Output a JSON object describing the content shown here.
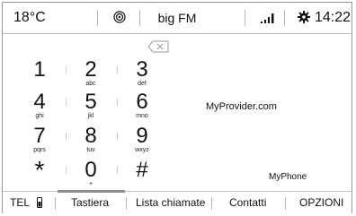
{
  "status_bar": {
    "temperature": "18°C",
    "radio_icon": "radio-signal-icon",
    "station": "big FM",
    "signal_icon": "signal-bars-icon",
    "settings_icon": "gear-icon",
    "time": "14:22"
  },
  "dialpad": {
    "keys": [
      {
        "digit": "1",
        "letters": ""
      },
      {
        "digit": "2",
        "letters": "abc"
      },
      {
        "digit": "3",
        "letters": "def"
      },
      {
        "digit": "4",
        "letters": "ghi"
      },
      {
        "digit": "5",
        "letters": "jkl"
      },
      {
        "digit": "6",
        "letters": "mno"
      },
      {
        "digit": "7",
        "letters": "pqrs"
      },
      {
        "digit": "8",
        "letters": "tuv"
      },
      {
        "digit": "9",
        "letters": "wxyz"
      },
      {
        "digit": "*",
        "letters": ""
      },
      {
        "digit": "0",
        "letters": "+"
      },
      {
        "digit": "#",
        "letters": ""
      }
    ],
    "backspace_icon": "backspace-icon"
  },
  "info": {
    "provider": "MyProvider.com",
    "phone_name": "MyPhone"
  },
  "tabs": {
    "tel": "TEL",
    "keypad": "Tastiera",
    "calls": "Lista chiamate",
    "contacts": "Contatti",
    "options": "OPZIONI"
  }
}
